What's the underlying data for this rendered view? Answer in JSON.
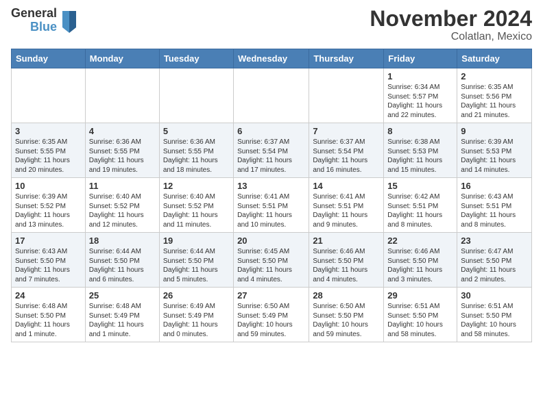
{
  "header": {
    "logo_general": "General",
    "logo_blue": "Blue",
    "title": "November 2024",
    "subtitle": "Colatlan, Mexico"
  },
  "days_of_week": [
    "Sunday",
    "Monday",
    "Tuesday",
    "Wednesday",
    "Thursday",
    "Friday",
    "Saturday"
  ],
  "weeks": [
    [
      {
        "day": "",
        "detail": ""
      },
      {
        "day": "",
        "detail": ""
      },
      {
        "day": "",
        "detail": ""
      },
      {
        "day": "",
        "detail": ""
      },
      {
        "day": "",
        "detail": ""
      },
      {
        "day": "1",
        "detail": "Sunrise: 6:34 AM\nSunset: 5:57 PM\nDaylight: 11 hours\nand 22 minutes."
      },
      {
        "day": "2",
        "detail": "Sunrise: 6:35 AM\nSunset: 5:56 PM\nDaylight: 11 hours\nand 21 minutes."
      }
    ],
    [
      {
        "day": "3",
        "detail": "Sunrise: 6:35 AM\nSunset: 5:55 PM\nDaylight: 11 hours\nand 20 minutes."
      },
      {
        "day": "4",
        "detail": "Sunrise: 6:36 AM\nSunset: 5:55 PM\nDaylight: 11 hours\nand 19 minutes."
      },
      {
        "day": "5",
        "detail": "Sunrise: 6:36 AM\nSunset: 5:55 PM\nDaylight: 11 hours\nand 18 minutes."
      },
      {
        "day": "6",
        "detail": "Sunrise: 6:37 AM\nSunset: 5:54 PM\nDaylight: 11 hours\nand 17 minutes."
      },
      {
        "day": "7",
        "detail": "Sunrise: 6:37 AM\nSunset: 5:54 PM\nDaylight: 11 hours\nand 16 minutes."
      },
      {
        "day": "8",
        "detail": "Sunrise: 6:38 AM\nSunset: 5:53 PM\nDaylight: 11 hours\nand 15 minutes."
      },
      {
        "day": "9",
        "detail": "Sunrise: 6:39 AM\nSunset: 5:53 PM\nDaylight: 11 hours\nand 14 minutes."
      }
    ],
    [
      {
        "day": "10",
        "detail": "Sunrise: 6:39 AM\nSunset: 5:52 PM\nDaylight: 11 hours\nand 13 minutes."
      },
      {
        "day": "11",
        "detail": "Sunrise: 6:40 AM\nSunset: 5:52 PM\nDaylight: 11 hours\nand 12 minutes."
      },
      {
        "day": "12",
        "detail": "Sunrise: 6:40 AM\nSunset: 5:52 PM\nDaylight: 11 hours\nand 11 minutes."
      },
      {
        "day": "13",
        "detail": "Sunrise: 6:41 AM\nSunset: 5:51 PM\nDaylight: 11 hours\nand 10 minutes."
      },
      {
        "day": "14",
        "detail": "Sunrise: 6:41 AM\nSunset: 5:51 PM\nDaylight: 11 hours\nand 9 minutes."
      },
      {
        "day": "15",
        "detail": "Sunrise: 6:42 AM\nSunset: 5:51 PM\nDaylight: 11 hours\nand 8 minutes."
      },
      {
        "day": "16",
        "detail": "Sunrise: 6:43 AM\nSunset: 5:51 PM\nDaylight: 11 hours\nand 8 minutes."
      }
    ],
    [
      {
        "day": "17",
        "detail": "Sunrise: 6:43 AM\nSunset: 5:50 PM\nDaylight: 11 hours\nand 7 minutes."
      },
      {
        "day": "18",
        "detail": "Sunrise: 6:44 AM\nSunset: 5:50 PM\nDaylight: 11 hours\nand 6 minutes."
      },
      {
        "day": "19",
        "detail": "Sunrise: 6:44 AM\nSunset: 5:50 PM\nDaylight: 11 hours\nand 5 minutes."
      },
      {
        "day": "20",
        "detail": "Sunrise: 6:45 AM\nSunset: 5:50 PM\nDaylight: 11 hours\nand 4 minutes."
      },
      {
        "day": "21",
        "detail": "Sunrise: 6:46 AM\nSunset: 5:50 PM\nDaylight: 11 hours\nand 4 minutes."
      },
      {
        "day": "22",
        "detail": "Sunrise: 6:46 AM\nSunset: 5:50 PM\nDaylight: 11 hours\nand 3 minutes."
      },
      {
        "day": "23",
        "detail": "Sunrise: 6:47 AM\nSunset: 5:50 PM\nDaylight: 11 hours\nand 2 minutes."
      }
    ],
    [
      {
        "day": "24",
        "detail": "Sunrise: 6:48 AM\nSunset: 5:50 PM\nDaylight: 11 hours\nand 1 minute."
      },
      {
        "day": "25",
        "detail": "Sunrise: 6:48 AM\nSunset: 5:49 PM\nDaylight: 11 hours\nand 1 minute."
      },
      {
        "day": "26",
        "detail": "Sunrise: 6:49 AM\nSunset: 5:49 PM\nDaylight: 11 hours\nand 0 minutes."
      },
      {
        "day": "27",
        "detail": "Sunrise: 6:50 AM\nSunset: 5:49 PM\nDaylight: 10 hours\nand 59 minutes."
      },
      {
        "day": "28",
        "detail": "Sunrise: 6:50 AM\nSunset: 5:50 PM\nDaylight: 10 hours\nand 59 minutes."
      },
      {
        "day": "29",
        "detail": "Sunrise: 6:51 AM\nSunset: 5:50 PM\nDaylight: 10 hours\nand 58 minutes."
      },
      {
        "day": "30",
        "detail": "Sunrise: 6:51 AM\nSunset: 5:50 PM\nDaylight: 10 hours\nand 58 minutes."
      }
    ]
  ]
}
